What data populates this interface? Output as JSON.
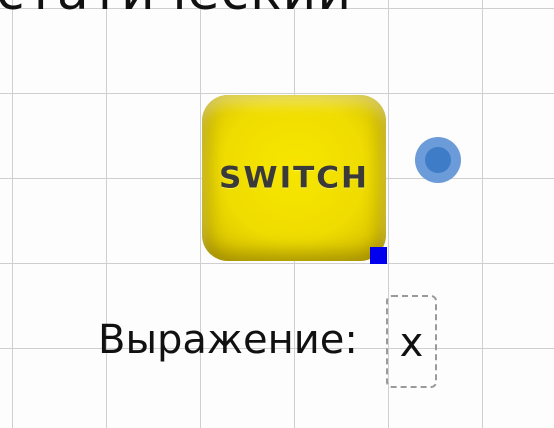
{
  "header": {
    "cut_title": "статический"
  },
  "block": {
    "label": "SWITCH",
    "color": "#f2df00",
    "handle_color": "#0000ee",
    "connector_color": "#4a86cf"
  },
  "expression": {
    "label": "Выражение:",
    "value": "x"
  }
}
